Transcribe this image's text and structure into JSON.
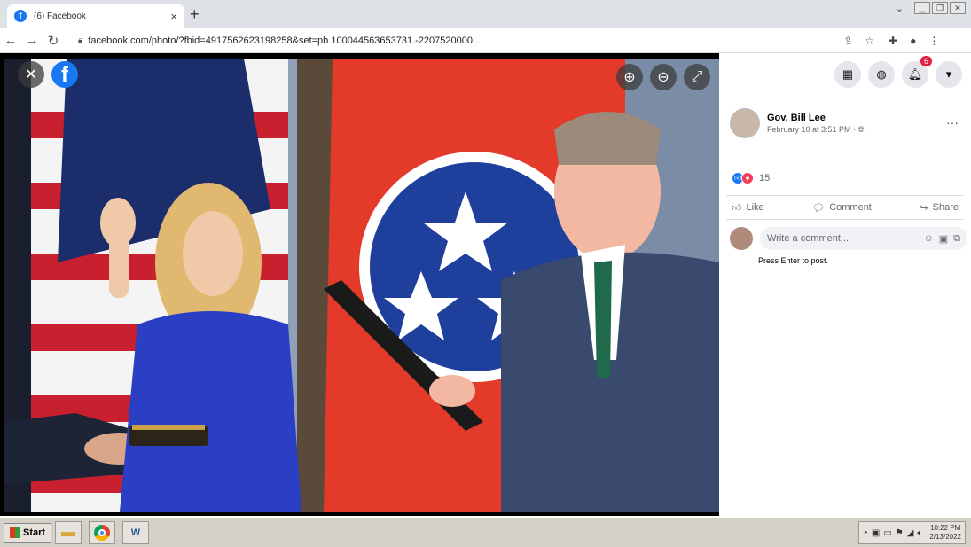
{
  "browser": {
    "tab_title": "(6) Facebook",
    "tab_close": "×",
    "new_tab": "+",
    "url": "facebook.com/photo/?fbid=4917562623198258&set=pb.100044563653731.-2207520000..."
  },
  "viewer": {
    "close_glyph": "✕",
    "logo_letter": "f",
    "zoom_in": "⊕",
    "zoom_out": "⊖",
    "fullscreen": "⤢"
  },
  "header_icons": {
    "notification_count": "6"
  },
  "post": {
    "author": "Gov. Bill Lee",
    "timestamp": "February 10 at 3:51 PM · ",
    "reaction_count": "15",
    "more": "···"
  },
  "actions": {
    "like": "Like",
    "comment": "Comment",
    "share": "Share"
  },
  "comment_box": {
    "placeholder": "Write a comment...",
    "hint": "Press Enter to post."
  },
  "taskbar": {
    "start_label": "Start",
    "clock_time": "10:22 PM",
    "clock_date": "2/13/2022"
  },
  "colors": {
    "facebook_blue": "#1877f2",
    "notification_red": "#e41e3f",
    "love_red": "#f33e58"
  }
}
